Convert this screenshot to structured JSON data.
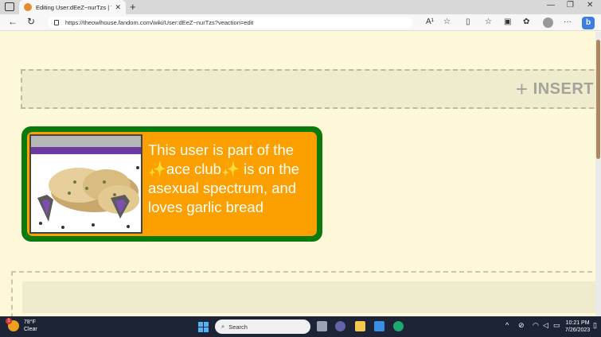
{
  "browser": {
    "tab_title": "Editing User:dEeZ~nurTzs | The",
    "url": "https://theowlhouse.fandom.com/wiki/User:dEeZ~nurTzs?veaction=edit",
    "read_aloud": "A¹"
  },
  "editor": {
    "insert_label": "INSERT",
    "userbox": {
      "text": "This user is part of the ✨ace club✨ is on the asexual spectrum, and loves garlic bread",
      "border_color": "#0a7a0a",
      "background_color": "#fba000"
    }
  },
  "taskbar": {
    "weather_temp": "78°F",
    "weather_desc": "Clear",
    "weather_badge": "1",
    "search_placeholder": "Search",
    "time": "10:21 PM",
    "date": "7/26/2023"
  }
}
